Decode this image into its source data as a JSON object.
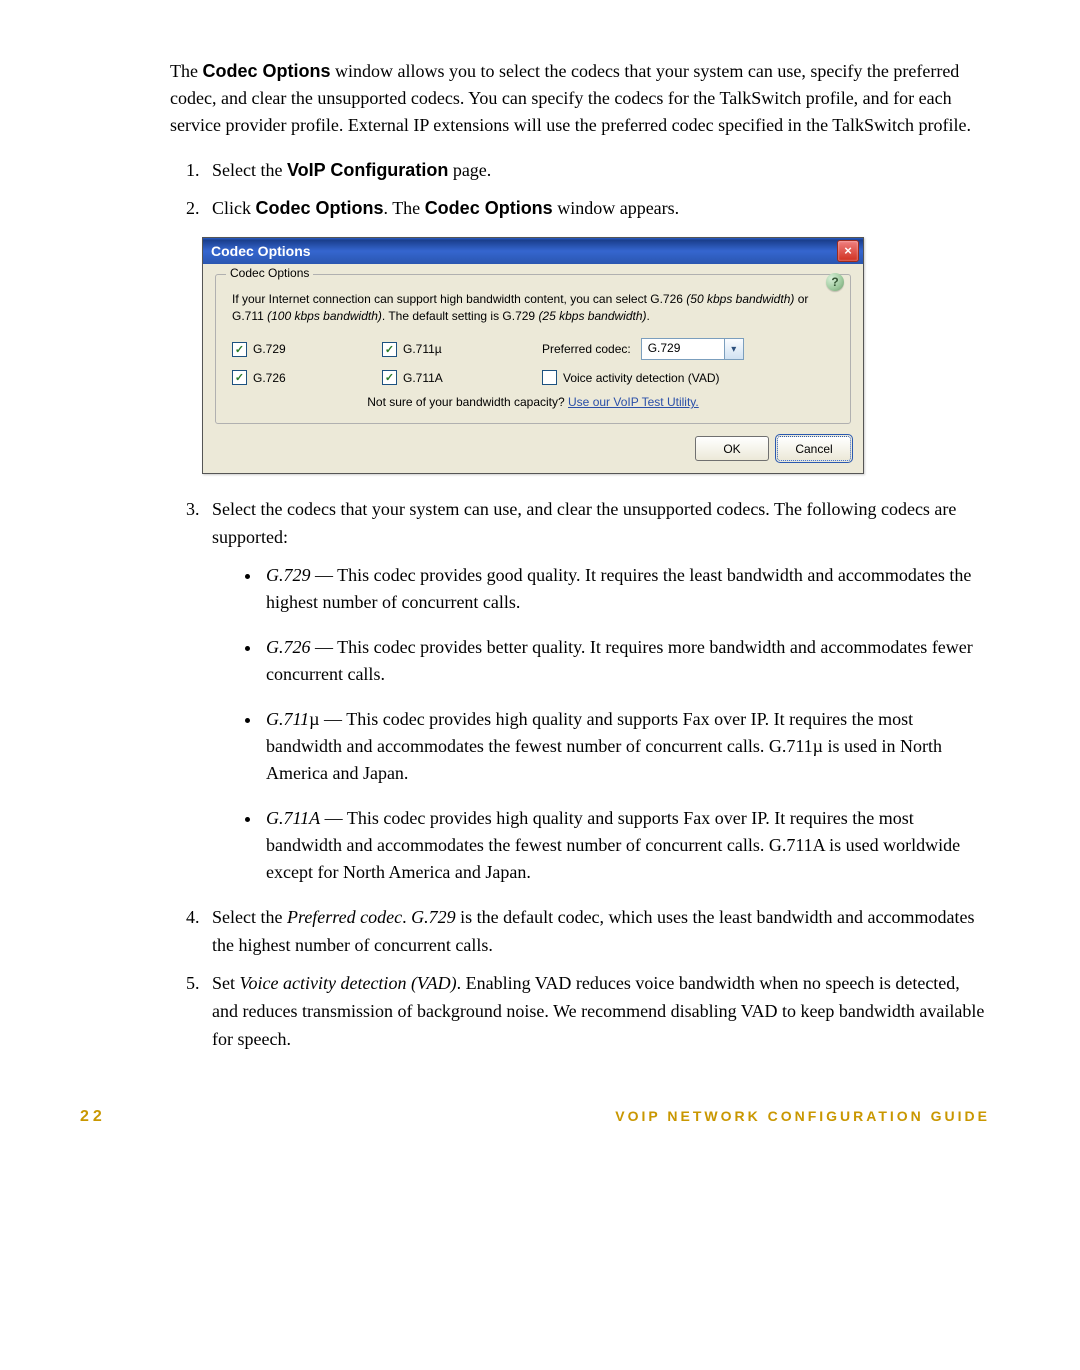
{
  "intro": {
    "p1_a": "The ",
    "p1_bold": "Codec Options",
    "p1_b": " window allows you to select the codecs that your system can use, specify the preferred codec, and clear the unsupported codecs. You can specify the codecs for the TalkSwitch profile, and for each service provider profile. External IP extensions will use the preferred codec specified in the TalkSwitch profile."
  },
  "steps12": {
    "s1_a": "Select the ",
    "s1_bold": "VoIP Configuration",
    "s1_b": " page.",
    "s2_a": "Click ",
    "s2_bold1": "Codec Options",
    "s2_b": ". The ",
    "s2_bold2": "Codec Options",
    "s2_c": " window appears."
  },
  "dialog": {
    "title": "Codec Options",
    "close": "×",
    "group": "Codec Options",
    "help": "?",
    "info_a": "If your Internet connection can support high bandwidth content, you can select G.726 ",
    "info_i1": "(50 kbps bandwidth)",
    "info_b": " or G.711 ",
    "info_i2": "(100 kbps bandwidth)",
    "info_c": ". The default setting is G.729 ",
    "info_i3": "(25 kbps bandwidth)",
    "info_d": ".",
    "cb1": "G.729",
    "cb2": "G.711µ",
    "cb3": "G.726",
    "cb4": "G.711A",
    "pref_label": "Preferred codec:",
    "pref_value": "G.729",
    "vad": "Voice activity detection (VAD)",
    "hint_a": "Not sure of your bandwidth capacity? ",
    "hint_link": "Use our VoIP Test Utility.",
    "ok": "OK",
    "cancel": "Cancel"
  },
  "step3": {
    "t": "Select the codecs that your system can use, and clear the unsupported codecs. The following codecs are supported:"
  },
  "bullets": {
    "b1_i": "G.729",
    "b1": " — This codec provides good quality. It requires the least bandwidth and accommodates the highest number of concurrent calls.",
    "b2_i": "G.726",
    "b2": " — This codec provides better quality. It requires more bandwidth and accommodates fewer concurrent calls.",
    "b3_i": "G.711",
    "b3_a": "µ — This codec provides high quality and supports Fax over IP. It requires the most bandwidth and accommodates the fewest number of concurrent calls. G.711µ is used in North America and Japan.",
    "b4_i": "G.711A",
    "b4": " — This codec provides high quality and supports Fax over IP. It requires the most bandwidth and accommodates the fewest number of concurrent calls. G.711A is used worldwide except for North America and Japan."
  },
  "step4": {
    "a": "Select the ",
    "i1": "Preferred codec",
    "b": ". ",
    "i2": "G.729",
    "c": " is the default codec, which uses the least bandwidth and accommodates the highest number of concurrent calls."
  },
  "step5": {
    "a": "Set ",
    "i1": "Voice activity detection (VAD)",
    "b": ". Enabling VAD reduces voice bandwidth when no speech is detected, and reduces transmission of background noise. We recommend disabling VAD to keep bandwidth available for speech."
  },
  "footer": {
    "page": "22",
    "title": "VOIP NETWORK CONFIGURATION GUIDE"
  }
}
